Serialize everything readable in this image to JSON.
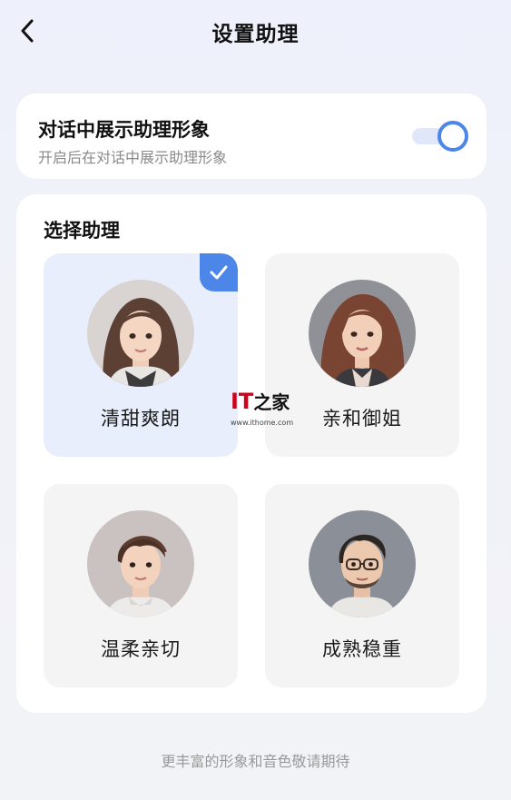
{
  "header": {
    "title": "设置助理",
    "back_icon": "chevron-left-icon"
  },
  "toggle_card": {
    "title": "对话中展示助理形象",
    "subtitle": "开启后在对话中展示助理形象",
    "enabled": true,
    "accent_color": "#4c86e8"
  },
  "select_card": {
    "title": "选择助理",
    "assistants": [
      {
        "label": "清甜爽朗",
        "selected": true,
        "avatar": "young-woman-brown-hair-avatar"
      },
      {
        "label": "亲和御姐",
        "selected": false,
        "avatar": "woman-wavy-auburn-hair-avatar"
      },
      {
        "label": "温柔亲切",
        "selected": false,
        "avatar": "young-man-short-hair-avatar"
      },
      {
        "label": "成熟稳重",
        "selected": false,
        "avatar": "man-glasses-beard-avatar"
      }
    ]
  },
  "watermark": {
    "logo_text": "IT之家",
    "url": "www.ithome.com"
  },
  "footer": {
    "note": "更丰富的形象和音色敬请期待"
  }
}
